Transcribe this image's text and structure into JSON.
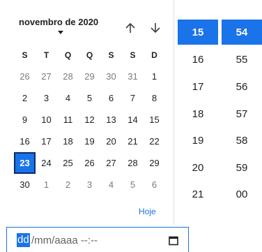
{
  "calendar": {
    "month_label": "novembro de 2020",
    "weekdays": [
      "S",
      "T",
      "Q",
      "Q",
      "S",
      "S",
      "D"
    ],
    "weeks": [
      [
        {
          "d": "26",
          "m": true
        },
        {
          "d": "27",
          "m": true
        },
        {
          "d": "28",
          "m": true
        },
        {
          "d": "29",
          "m": true
        },
        {
          "d": "30",
          "m": true
        },
        {
          "d": "31",
          "m": true
        },
        {
          "d": "1",
          "m": false
        }
      ],
      [
        {
          "d": "2",
          "m": false
        },
        {
          "d": "3",
          "m": false
        },
        {
          "d": "4",
          "m": false
        },
        {
          "d": "5",
          "m": false
        },
        {
          "d": "6",
          "m": false
        },
        {
          "d": "7",
          "m": false
        },
        {
          "d": "8",
          "m": false
        }
      ],
      [
        {
          "d": "9",
          "m": false
        },
        {
          "d": "10",
          "m": false
        },
        {
          "d": "11",
          "m": false
        },
        {
          "d": "12",
          "m": false
        },
        {
          "d": "13",
          "m": false
        },
        {
          "d": "14",
          "m": false
        },
        {
          "d": "15",
          "m": false
        }
      ],
      [
        {
          "d": "16",
          "m": false
        },
        {
          "d": "17",
          "m": false
        },
        {
          "d": "18",
          "m": false
        },
        {
          "d": "19",
          "m": false
        },
        {
          "d": "20",
          "m": false
        },
        {
          "d": "21",
          "m": false
        },
        {
          "d": "22",
          "m": false
        }
      ],
      [
        {
          "d": "23",
          "m": false,
          "selected": true
        },
        {
          "d": "24",
          "m": false
        },
        {
          "d": "25",
          "m": false
        },
        {
          "d": "26",
          "m": false
        },
        {
          "d": "27",
          "m": false
        },
        {
          "d": "28",
          "m": false
        },
        {
          "d": "29",
          "m": false
        }
      ],
      [
        {
          "d": "30",
          "m": false
        },
        {
          "d": "1",
          "m": true
        },
        {
          "d": "2",
          "m": true
        },
        {
          "d": "3",
          "m": true
        },
        {
          "d": "4",
          "m": true
        },
        {
          "d": "5",
          "m": true
        },
        {
          "d": "6",
          "m": true
        }
      ]
    ],
    "today_label": "Hoje"
  },
  "time": {
    "hours": [
      "15",
      "16",
      "17",
      "18",
      "19",
      "20",
      "21"
    ],
    "minutes": [
      "54",
      "55",
      "56",
      "57",
      "58",
      "59",
      "00"
    ],
    "selected_hour": "15",
    "selected_minute": "54"
  },
  "input": {
    "segment_day": "dd",
    "rest": "/mm/aaaa --:--"
  },
  "colors": {
    "accent": "#1a73e8",
    "muted_text": "#7a7a7a"
  },
  "icons": {
    "nav_up": "arrow-up-icon",
    "nav_down": "arrow-down-icon",
    "month_dropdown": "caret-down-icon",
    "picker": "calendar-icon"
  }
}
